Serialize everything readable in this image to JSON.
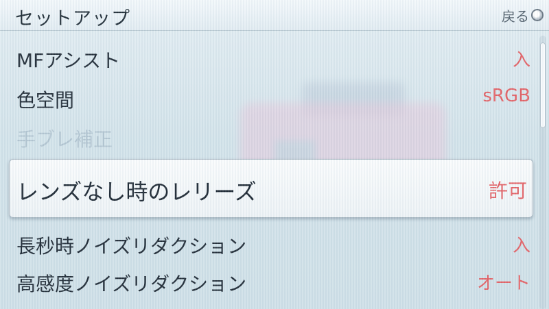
{
  "header": {
    "title": "セットアップ",
    "back_label": "戻る"
  },
  "menu": {
    "items": [
      {
        "label": "MFアシスト",
        "value": "入",
        "enabled": true,
        "selected": false
      },
      {
        "label": "色空間",
        "value": "sRGB",
        "enabled": true,
        "selected": false
      },
      {
        "label": "手ブレ補正",
        "value": "",
        "enabled": false,
        "selected": false
      },
      {
        "label": "レンズなし時のレリーズ",
        "value": "許可",
        "enabled": true,
        "selected": true
      },
      {
        "label": "長秒時ノイズリダクション",
        "value": "入",
        "enabled": true,
        "selected": false
      },
      {
        "label": "高感度ノイズリダクション",
        "value": "オート",
        "enabled": true,
        "selected": false
      }
    ]
  },
  "colors": {
    "value_text": "#e35f63",
    "label_text": "#1d2833",
    "disabled_text": "#b3c6d2"
  },
  "icons": {
    "back": "circle-back-icon"
  }
}
